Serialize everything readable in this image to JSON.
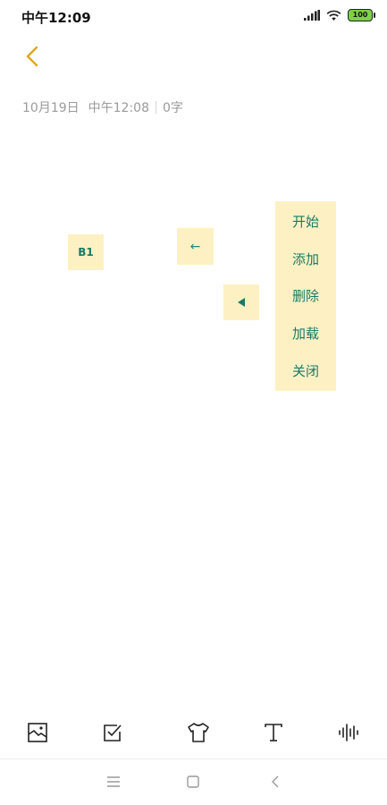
{
  "status_bar": {
    "time": "中午12:09",
    "battery": "100"
  },
  "note": {
    "date": "10月19日",
    "time": "中午12:08",
    "word_count": "0字"
  },
  "floating": {
    "b1_label": "B1",
    "left_arrow_label": "←"
  },
  "menu": {
    "items": [
      "开始",
      "添加",
      "删除",
      "加载",
      "关闭"
    ]
  },
  "colors": {
    "accent": "#e0a81e",
    "chip_bg": "#fdf1c4",
    "chip_text": "#1a7a66"
  },
  "toolbar": {
    "icons": [
      "image-icon",
      "checkbox-icon",
      "shirt-icon",
      "text-icon",
      "audio-wave-icon"
    ]
  },
  "nav": {
    "icons": [
      "menu-icon",
      "home-icon",
      "back-icon"
    ]
  }
}
